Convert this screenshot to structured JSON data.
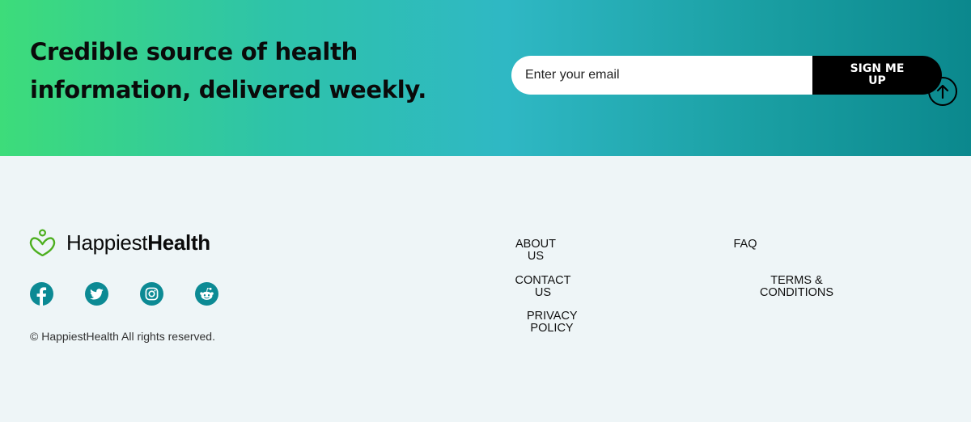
{
  "banner": {
    "title_line1": "Credible source of health",
    "title_line2": "information, delivered weekly.",
    "email_placeholder": "Enter your email",
    "signup_label": "SIGN ME UP"
  },
  "brand": {
    "name_light": "Happiest",
    "name_bold": "Health"
  },
  "social": [
    {
      "icon": "facebook-icon"
    },
    {
      "icon": "twitter-icon"
    },
    {
      "icon": "instagram-icon"
    },
    {
      "icon": "reddit-icon"
    }
  ],
  "copyright": "© HappiestHealth All rights reserved.",
  "links": {
    "about": "ABOUT US",
    "contact": "CONTACT US",
    "privacy": "PRIVACY POLICY",
    "faq": "FAQ",
    "terms": "TERMS & CONDITIONS"
  },
  "colors": {
    "gradient_start": "#3ddc7a",
    "gradient_end": "#0b888d",
    "social_bg": "#0c8a94",
    "logo_green": "#4caf1e",
    "footer_bg": "#eef5f7"
  }
}
